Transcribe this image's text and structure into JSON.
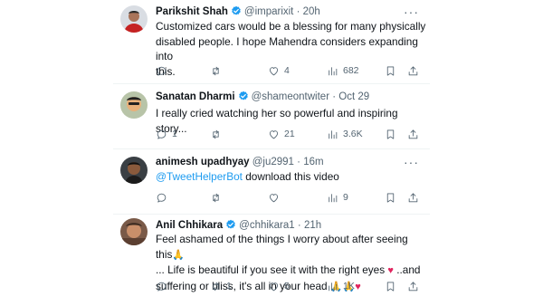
{
  "tweets": [
    {
      "name": "Parikshit Shah",
      "handle": "@imparixit",
      "sep": "·",
      "time": "20h",
      "verified": true,
      "lines": [
        "Customized cars would be a blessing for many physically",
        "disabled people. I hope Mahendra considers expanding into",
        "this."
      ],
      "replies": "",
      "reposts": "",
      "likes": "4",
      "views": "682"
    },
    {
      "name": "Sanatan Dharmi",
      "handle": "@shameontwiter",
      "sep": "·",
      "time": "Oct 29",
      "verified": true,
      "lines": [
        "I really cried watching her so powerful and inspiring story..."
      ],
      "replies": "1",
      "reposts": "",
      "likes": "21",
      "views": "3.6K"
    },
    {
      "name": "animesh upadhyay",
      "handle": "@ju2991",
      "sep": "·",
      "time": "16m",
      "verified": false,
      "mention": "@TweetHelperBot",
      "text_after_mention": " download this video",
      "replies": "",
      "reposts": "",
      "likes": "",
      "views": "9"
    },
    {
      "name": "Anil Chhikara",
      "handle": "@chhikara1",
      "sep": "·",
      "time": "21h",
      "verified": true,
      "line1": "Feel ashamed of the things I worry about after seeing this",
      "line2a": "... Life is beautiful if you see it with the right eyes ",
      "line2b": " ..and",
      "line3": "suffering or bliss, it's all in your head ",
      "emoji_folded_hands": "🙏",
      "emoji_heart": "♥",
      "replies": "",
      "reposts": "1",
      "likes": "5",
      "views": "1K"
    }
  ],
  "icons": {
    "reply": "reply-icon",
    "repost": "repost-icon",
    "like": "heart-icon",
    "views": "views-icon",
    "bookmark": "bookmark-icon",
    "share": "share-icon",
    "verified": "verified-badge-icon",
    "more": "more-options-icon"
  },
  "colors": {
    "verified": "#1d9bf0",
    "mention": "#1d9bf0",
    "text": "#0f1419",
    "muted": "#536471"
  }
}
